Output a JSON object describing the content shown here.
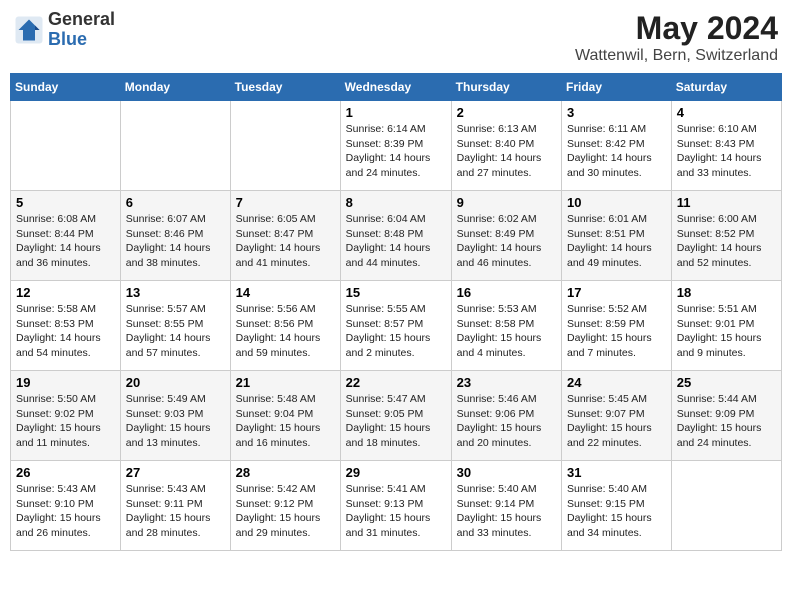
{
  "header": {
    "logo_general": "General",
    "logo_blue": "Blue",
    "month_year": "May 2024",
    "location": "Wattenwil, Bern, Switzerland"
  },
  "weekdays": [
    "Sunday",
    "Monday",
    "Tuesday",
    "Wednesday",
    "Thursday",
    "Friday",
    "Saturday"
  ],
  "weeks": [
    [
      {
        "day": "",
        "sunrise": "",
        "sunset": "",
        "daylight": ""
      },
      {
        "day": "",
        "sunrise": "",
        "sunset": "",
        "daylight": ""
      },
      {
        "day": "",
        "sunrise": "",
        "sunset": "",
        "daylight": ""
      },
      {
        "day": "1",
        "sunrise": "Sunrise: 6:14 AM",
        "sunset": "Sunset: 8:39 PM",
        "daylight": "Daylight: 14 hours and 24 minutes."
      },
      {
        "day": "2",
        "sunrise": "Sunrise: 6:13 AM",
        "sunset": "Sunset: 8:40 PM",
        "daylight": "Daylight: 14 hours and 27 minutes."
      },
      {
        "day": "3",
        "sunrise": "Sunrise: 6:11 AM",
        "sunset": "Sunset: 8:42 PM",
        "daylight": "Daylight: 14 hours and 30 minutes."
      },
      {
        "day": "4",
        "sunrise": "Sunrise: 6:10 AM",
        "sunset": "Sunset: 8:43 PM",
        "daylight": "Daylight: 14 hours and 33 minutes."
      }
    ],
    [
      {
        "day": "5",
        "sunrise": "Sunrise: 6:08 AM",
        "sunset": "Sunset: 8:44 PM",
        "daylight": "Daylight: 14 hours and 36 minutes."
      },
      {
        "day": "6",
        "sunrise": "Sunrise: 6:07 AM",
        "sunset": "Sunset: 8:46 PM",
        "daylight": "Daylight: 14 hours and 38 minutes."
      },
      {
        "day": "7",
        "sunrise": "Sunrise: 6:05 AM",
        "sunset": "Sunset: 8:47 PM",
        "daylight": "Daylight: 14 hours and 41 minutes."
      },
      {
        "day": "8",
        "sunrise": "Sunrise: 6:04 AM",
        "sunset": "Sunset: 8:48 PM",
        "daylight": "Daylight: 14 hours and 44 minutes."
      },
      {
        "day": "9",
        "sunrise": "Sunrise: 6:02 AM",
        "sunset": "Sunset: 8:49 PM",
        "daylight": "Daylight: 14 hours and 46 minutes."
      },
      {
        "day": "10",
        "sunrise": "Sunrise: 6:01 AM",
        "sunset": "Sunset: 8:51 PM",
        "daylight": "Daylight: 14 hours and 49 minutes."
      },
      {
        "day": "11",
        "sunrise": "Sunrise: 6:00 AM",
        "sunset": "Sunset: 8:52 PM",
        "daylight": "Daylight: 14 hours and 52 minutes."
      }
    ],
    [
      {
        "day": "12",
        "sunrise": "Sunrise: 5:58 AM",
        "sunset": "Sunset: 8:53 PM",
        "daylight": "Daylight: 14 hours and 54 minutes."
      },
      {
        "day": "13",
        "sunrise": "Sunrise: 5:57 AM",
        "sunset": "Sunset: 8:55 PM",
        "daylight": "Daylight: 14 hours and 57 minutes."
      },
      {
        "day": "14",
        "sunrise": "Sunrise: 5:56 AM",
        "sunset": "Sunset: 8:56 PM",
        "daylight": "Daylight: 14 hours and 59 minutes."
      },
      {
        "day": "15",
        "sunrise": "Sunrise: 5:55 AM",
        "sunset": "Sunset: 8:57 PM",
        "daylight": "Daylight: 15 hours and 2 minutes."
      },
      {
        "day": "16",
        "sunrise": "Sunrise: 5:53 AM",
        "sunset": "Sunset: 8:58 PM",
        "daylight": "Daylight: 15 hours and 4 minutes."
      },
      {
        "day": "17",
        "sunrise": "Sunrise: 5:52 AM",
        "sunset": "Sunset: 8:59 PM",
        "daylight": "Daylight: 15 hours and 7 minutes."
      },
      {
        "day": "18",
        "sunrise": "Sunrise: 5:51 AM",
        "sunset": "Sunset: 9:01 PM",
        "daylight": "Daylight: 15 hours and 9 minutes."
      }
    ],
    [
      {
        "day": "19",
        "sunrise": "Sunrise: 5:50 AM",
        "sunset": "Sunset: 9:02 PM",
        "daylight": "Daylight: 15 hours and 11 minutes."
      },
      {
        "day": "20",
        "sunrise": "Sunrise: 5:49 AM",
        "sunset": "Sunset: 9:03 PM",
        "daylight": "Daylight: 15 hours and 13 minutes."
      },
      {
        "day": "21",
        "sunrise": "Sunrise: 5:48 AM",
        "sunset": "Sunset: 9:04 PM",
        "daylight": "Daylight: 15 hours and 16 minutes."
      },
      {
        "day": "22",
        "sunrise": "Sunrise: 5:47 AM",
        "sunset": "Sunset: 9:05 PM",
        "daylight": "Daylight: 15 hours and 18 minutes."
      },
      {
        "day": "23",
        "sunrise": "Sunrise: 5:46 AM",
        "sunset": "Sunset: 9:06 PM",
        "daylight": "Daylight: 15 hours and 20 minutes."
      },
      {
        "day": "24",
        "sunrise": "Sunrise: 5:45 AM",
        "sunset": "Sunset: 9:07 PM",
        "daylight": "Daylight: 15 hours and 22 minutes."
      },
      {
        "day": "25",
        "sunrise": "Sunrise: 5:44 AM",
        "sunset": "Sunset: 9:09 PM",
        "daylight": "Daylight: 15 hours and 24 minutes."
      }
    ],
    [
      {
        "day": "26",
        "sunrise": "Sunrise: 5:43 AM",
        "sunset": "Sunset: 9:10 PM",
        "daylight": "Daylight: 15 hours and 26 minutes."
      },
      {
        "day": "27",
        "sunrise": "Sunrise: 5:43 AM",
        "sunset": "Sunset: 9:11 PM",
        "daylight": "Daylight: 15 hours and 28 minutes."
      },
      {
        "day": "28",
        "sunrise": "Sunrise: 5:42 AM",
        "sunset": "Sunset: 9:12 PM",
        "daylight": "Daylight: 15 hours and 29 minutes."
      },
      {
        "day": "29",
        "sunrise": "Sunrise: 5:41 AM",
        "sunset": "Sunset: 9:13 PM",
        "daylight": "Daylight: 15 hours and 31 minutes."
      },
      {
        "day": "30",
        "sunrise": "Sunrise: 5:40 AM",
        "sunset": "Sunset: 9:14 PM",
        "daylight": "Daylight: 15 hours and 33 minutes."
      },
      {
        "day": "31",
        "sunrise": "Sunrise: 5:40 AM",
        "sunset": "Sunset: 9:15 PM",
        "daylight": "Daylight: 15 hours and 34 minutes."
      },
      {
        "day": "",
        "sunrise": "",
        "sunset": "",
        "daylight": ""
      }
    ]
  ]
}
